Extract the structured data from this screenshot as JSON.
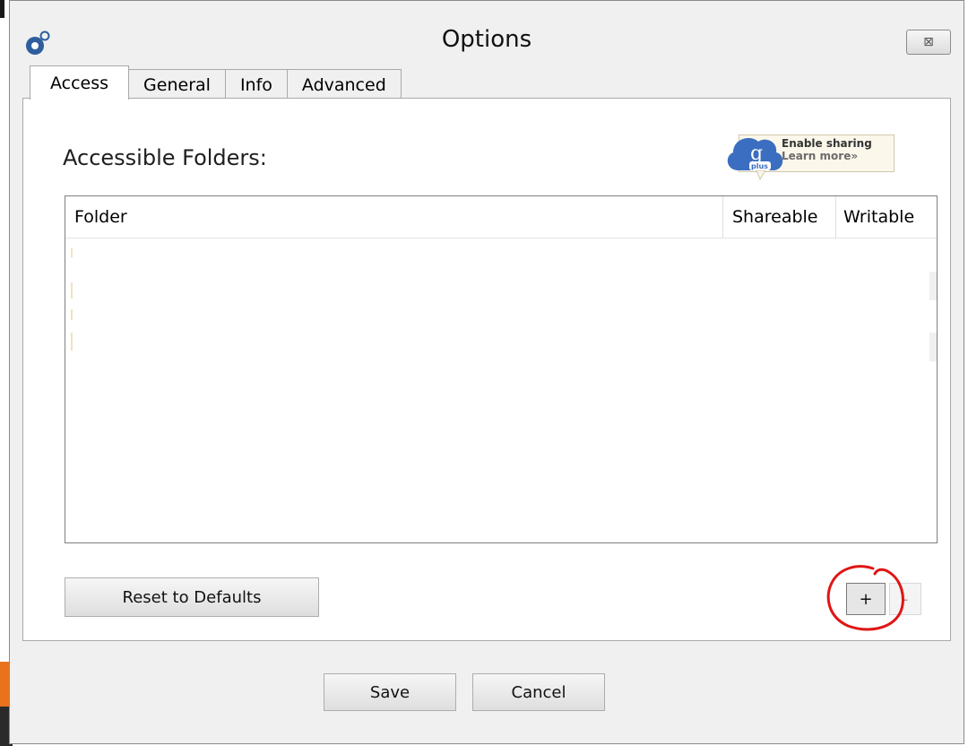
{
  "window": {
    "title": "Options",
    "close_label": "⊠"
  },
  "tabs": [
    {
      "label": "Access",
      "active": true
    },
    {
      "label": "General",
      "active": false
    },
    {
      "label": "Info",
      "active": false
    },
    {
      "label": "Advanced",
      "active": false
    }
  ],
  "access": {
    "heading": "Accessible Folders:",
    "gplus": {
      "badge_text": "g",
      "badge_subtext": "plus",
      "line1": "Enable sharing",
      "line2": "Learn more»"
    },
    "table": {
      "columns": [
        "Folder",
        "Shareable",
        "Writable"
      ],
      "rows": []
    },
    "reset_label": "Reset to Defaults",
    "add_label": "+",
    "remove_label": "-"
  },
  "footer": {
    "save_label": "Save",
    "cancel_label": "Cancel"
  },
  "colors": {
    "annotation": "#e01515",
    "orange_strip": "#e8731c"
  },
  "icons": {
    "app": "app-logo-icon",
    "close": "close-icon",
    "gplus": "gplus-icon"
  }
}
